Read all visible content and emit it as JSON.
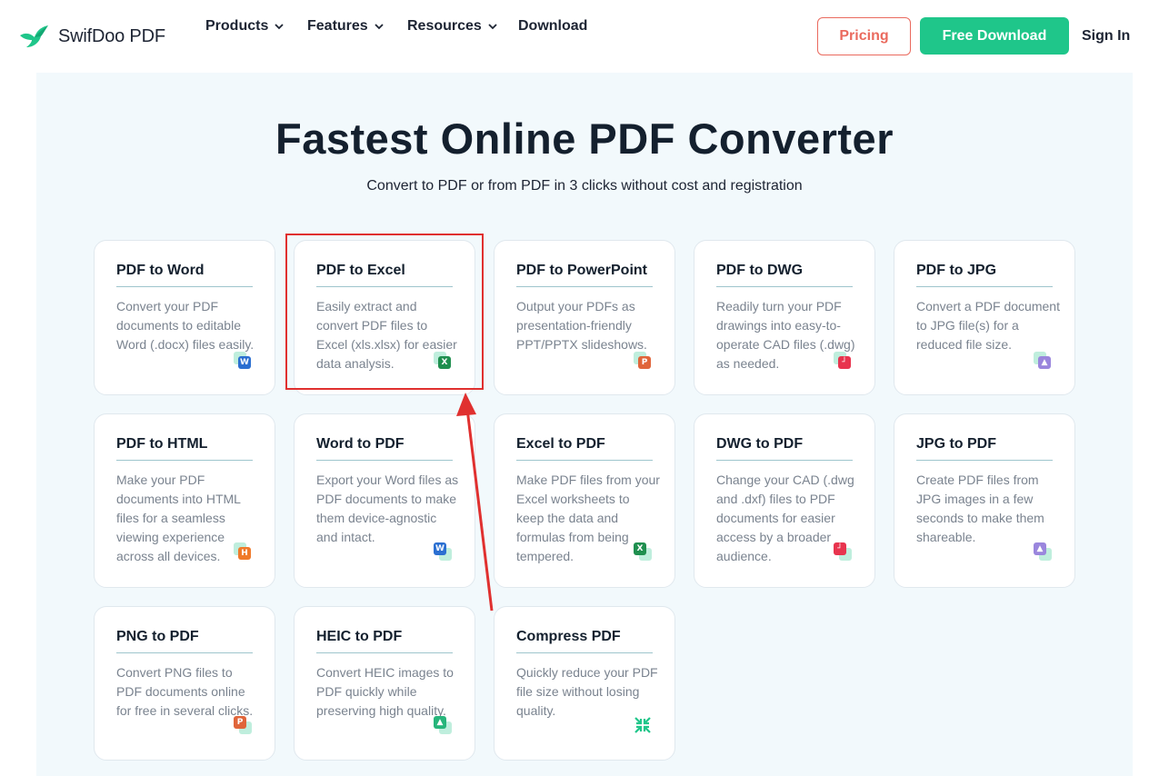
{
  "header": {
    "logo_text": "SwifDoo PDF",
    "nav": [
      {
        "label": "Products",
        "has_dropdown": true
      },
      {
        "label": "Features",
        "has_dropdown": true
      },
      {
        "label": "Resources",
        "has_dropdown": true
      },
      {
        "label": "Download",
        "has_dropdown": false
      }
    ],
    "pricing_label": "Pricing",
    "free_download_label": "Free Download",
    "sign_in_label": "Sign In"
  },
  "hero": {
    "title": "Fastest Online PDF Converter",
    "subtitle": "Convert to PDF or from PDF in 3 clicks without cost and registration"
  },
  "cards": [
    {
      "title": "PDF to Word",
      "desc": "Convert your PDF documents to editable Word (.docx) files easily.",
      "icon": "word-icon",
      "badge": "W",
      "color": "#2b6fd1"
    },
    {
      "title": "PDF to Excel",
      "desc": "Easily extract and convert PDF files to Excel (xls.xlsx) for easier data analysis.",
      "icon": "excel-icon",
      "badge": "X",
      "color": "#1f8f4f"
    },
    {
      "title": "PDF to PowerPoint",
      "desc": "Output your PDFs as presentation-friendly PPT/PPTX slideshows.",
      "icon": "powerpoint-icon",
      "badge": "P",
      "color": "#e0653a"
    },
    {
      "title": "PDF to DWG",
      "desc": "Readily turn your PDF drawings into easy-to-operate CAD files (.dwg) as needed.",
      "icon": "dwg-icon",
      "badge": "┘",
      "color": "#e8344e"
    },
    {
      "title": "PDF to JPG",
      "desc": "Convert a PDF document to JPG file(s) for a reduced file size.",
      "icon": "image-icon",
      "badge": "▲",
      "color": "#9a86dd"
    },
    {
      "title": "PDF to HTML",
      "desc": "Make your PDF documents into HTML files for a seamless viewing experience across all devices.",
      "icon": "html-icon",
      "badge": "H",
      "color": "#f07a2a"
    },
    {
      "title": "Word to PDF",
      "desc": "Export your Word files as PDF documents to make them device-agnostic and intact.",
      "icon": "word-icon",
      "badge": "W",
      "color": "#2b6fd1"
    },
    {
      "title": "Excel to PDF",
      "desc": "Make PDF files from your Excel worksheets to keep the data and formulas from being tempered.",
      "icon": "excel-icon",
      "badge": "X",
      "color": "#1f8f4f"
    },
    {
      "title": "DWG to PDF",
      "desc": "Change your CAD (.dwg and .dxf) files to PDF documents for easier access by a broader audience.",
      "icon": "dwg-icon",
      "badge": "┘",
      "color": "#e8344e"
    },
    {
      "title": "JPG to PDF",
      "desc": "Create PDF files from JPG images in a few seconds to make them shareable.",
      "icon": "image-icon",
      "badge": "▲",
      "color": "#9a86dd"
    },
    {
      "title": "PNG to PDF",
      "desc": "Convert PNG files to PDF documents online for free in several clicks.",
      "icon": "png-icon",
      "badge": "P",
      "color": "#e0653a"
    },
    {
      "title": "HEIC to PDF",
      "desc": "Convert HEIC images to PDF quickly while preserving high quality.",
      "icon": "heic-icon",
      "badge": "▲",
      "color": "#27b57b"
    },
    {
      "title": "Compress PDF",
      "desc": "Quickly reduce your PDF file size without losing quality.",
      "icon": "compress-icon",
      "badge": "",
      "color": "#1fc68a"
    }
  ]
}
